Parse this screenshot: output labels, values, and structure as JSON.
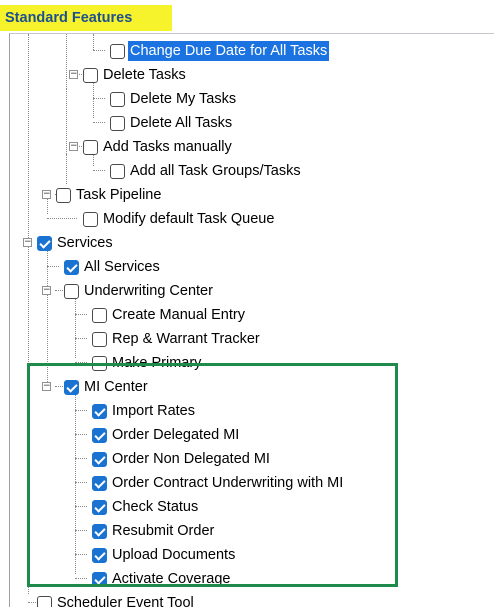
{
  "header": {
    "title": "Standard Features"
  },
  "tree": {
    "items": [
      {
        "label": "Change Due Date for All Tasks",
        "checked": false,
        "selected": true
      },
      {
        "label": "Delete Tasks",
        "checked": false,
        "expanded": true
      },
      {
        "label": "Delete My Tasks",
        "checked": false
      },
      {
        "label": "Delete All Tasks",
        "checked": false
      },
      {
        "label": "Add Tasks manually",
        "checked": false,
        "expanded": true
      },
      {
        "label": "Add all Task Groups/Tasks",
        "checked": false
      },
      {
        "label": "Task Pipeline",
        "checked": false,
        "expanded": true
      },
      {
        "label": "Modify default Task Queue",
        "checked": false
      },
      {
        "label": "Services",
        "checked": true,
        "expanded": true
      },
      {
        "label": "All Services",
        "checked": true
      },
      {
        "label": "Underwriting Center",
        "checked": false,
        "expanded": true
      },
      {
        "label": "Create Manual Entry",
        "checked": false
      },
      {
        "label": "Rep & Warrant Tracker",
        "checked": false
      },
      {
        "label": "Make Primary",
        "checked": false
      },
      {
        "label": "MI Center",
        "checked": true,
        "expanded": true
      },
      {
        "label": "Import Rates",
        "checked": true
      },
      {
        "label": "Order Delegated MI",
        "checked": true
      },
      {
        "label": "Order Non Delegated MI",
        "checked": true
      },
      {
        "label": "Order Contract Underwriting with MI",
        "checked": true
      },
      {
        "label": "Check Status",
        "checked": true
      },
      {
        "label": "Resubmit Order",
        "checked": true
      },
      {
        "label": "Upload Documents",
        "checked": true
      },
      {
        "label": "Activate Coverage",
        "checked": true
      },
      {
        "label": "Scheduler Event Tool",
        "checked": false
      }
    ]
  },
  "colors": {
    "header_bg": "#f6f32c",
    "header_text": "#1e4f8f",
    "checkbox_checked": "#1a73d1",
    "selection": "#1a73e0",
    "highlight_box": "#1e8a4c"
  }
}
